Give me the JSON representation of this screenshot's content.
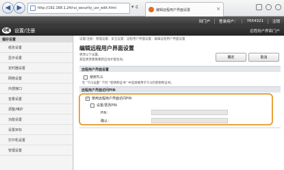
{
  "browser": {
    "url": "http://192.168.1.24/rui_security_usr_edit.html",
    "tab_title": "编辑远程用户界面设置",
    "tools_label": "▾ ¢"
  },
  "header": {
    "toplinks": [
      "到门户",
      "登录用户：",
      "7654321",
      "注销"
    ],
    "device_label": "××××××",
    "app_title": "设置/注册",
    "logo_text": "OE",
    "portal_link": "远程用户界面门户"
  },
  "sidebar": {
    "heading": "偏好设置",
    "items": [
      "纸张设置",
      "显示设置",
      "定时器设置",
      "网络设置",
      "外部接口",
      "音量设置",
      "调整/维护",
      "功能设置",
      "设置目标",
      "打印机设置",
      "管理设置"
    ]
  },
  "main": {
    "breadcrumb": "设置/注册：管理设置：安全设置：远程用户界面设置：编辑远程用户界面设置",
    "title": "编辑远程用户界面设置",
    "note1": "更改以下设置。",
    "note2": "某些更改需要重新启动才能生效。",
    "ok_label": "确定",
    "cancel_label": "取消",
    "section1": "远程用户界面设置",
    "use_tls": "使用TLS",
    "hint": "在 \"TLS设置\" 下的 \"密钥和证书\" 中选择要用于TLS的密钥和证书。",
    "section2": "远程用户界面访问PIN",
    "use_pin": "使用远程用户界面访问PIN",
    "set_change_pin": "设置/更改PIN",
    "pin_label": "PIN：",
    "confirm_label": "确认："
  }
}
